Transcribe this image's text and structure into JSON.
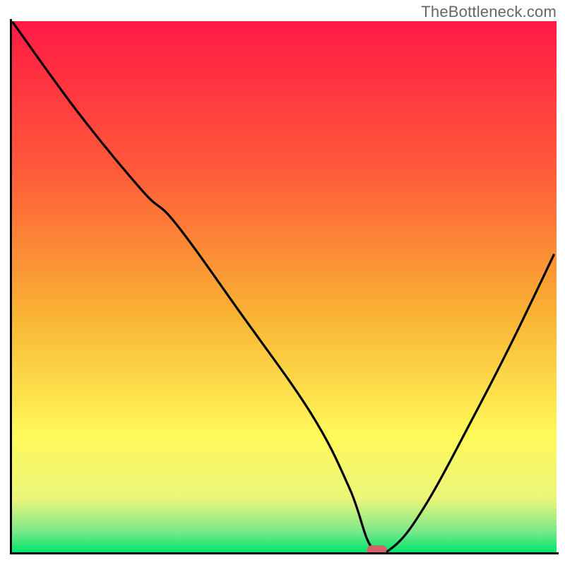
{
  "watermark": "TheBottleneck.com",
  "chart_data": {
    "type": "line",
    "title": "",
    "xlabel": "",
    "ylabel": "",
    "xlim": [
      0,
      100
    ],
    "ylim": [
      0,
      100
    ],
    "grid": false,
    "gradient_top_color": "#ff1a44",
    "gradient_mid_color": "#f9b233",
    "gradient_low_color": "#fff95a",
    "gradient_band_color": "#eaf57a",
    "gradient_bottom_color": "#00e56a",
    "marker": {
      "x": 67,
      "y": 0.5,
      "color": "#d46262",
      "shape": "pill"
    },
    "series": [
      {
        "name": "curve",
        "color": "#000000",
        "x": [
          0,
          12,
          24,
          30,
          42,
          55,
          62,
          66,
          70,
          76,
          85,
          92,
          99.5
        ],
        "y": [
          100,
          83,
          68,
          62,
          45,
          26,
          12,
          1,
          1,
          9,
          26,
          40,
          56
        ]
      }
    ]
  }
}
